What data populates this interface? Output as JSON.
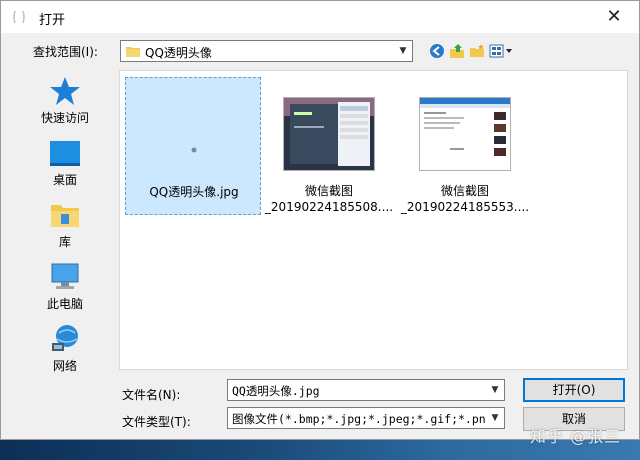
{
  "window": {
    "title": "打开"
  },
  "lookin": {
    "label": "查找范围(I):",
    "value": "QQ透明头像"
  },
  "places": [
    {
      "label": "快速访问",
      "icon": "star-icon"
    },
    {
      "label": "桌面",
      "icon": "desktop-icon"
    },
    {
      "label": "库",
      "icon": "library-icon"
    },
    {
      "label": "此电脑",
      "icon": "computer-icon"
    },
    {
      "label": "网络",
      "icon": "network-icon"
    }
  ],
  "files": [
    {
      "line1": "QQ透明头像.jpg",
      "line2": "",
      "selected": true
    },
    {
      "line1": "微信截图",
      "line2": "_20190224185508....",
      "selected": false
    },
    {
      "line1": "微信截图",
      "line2": "_20190224185553....",
      "selected": false
    }
  ],
  "filename": {
    "label": "文件名(N):",
    "value": "QQ透明头像.jpg"
  },
  "filetype": {
    "label": "文件类型(T):",
    "value": "图像文件(*.bmp;*.jpg;*.jpeg;*.gif;*.pn"
  },
  "buttons": {
    "open": "打开(O)",
    "cancel": "取消"
  },
  "watermark": "知乎 @张三",
  "colors": {
    "selection": "#cce8ff",
    "accent": "#0078d7"
  }
}
